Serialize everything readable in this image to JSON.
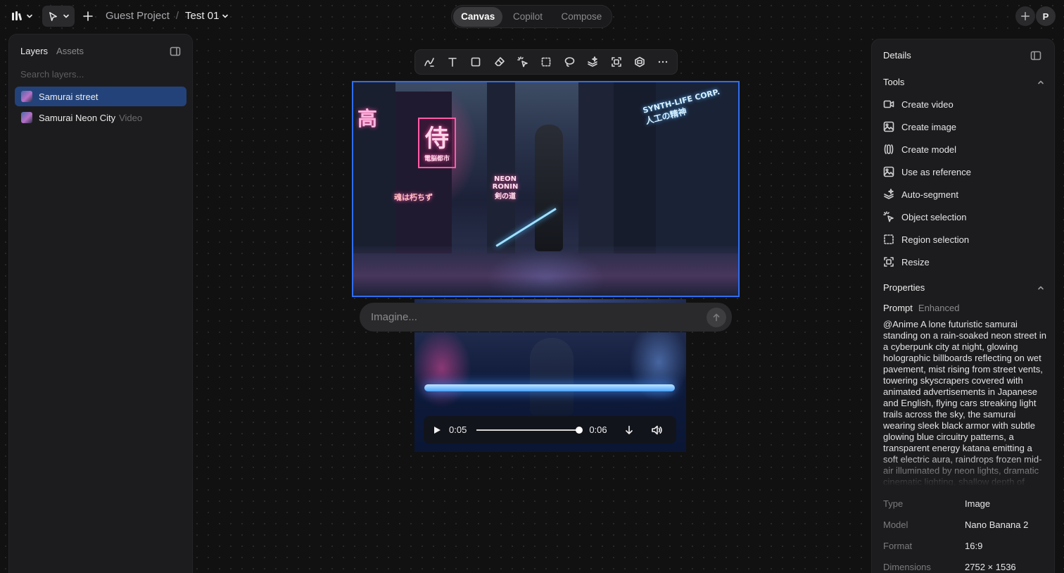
{
  "header": {
    "project": "Guest Project",
    "separator": "/",
    "file": "Test 01",
    "avatar_initial": "P",
    "modes": [
      {
        "label": "Canvas",
        "active": true
      },
      {
        "label": "Copilot",
        "active": false
      },
      {
        "label": "Compose",
        "active": false
      }
    ]
  },
  "left_panel": {
    "tabs": [
      {
        "label": "Layers",
        "active": true
      },
      {
        "label": "Assets",
        "active": false
      }
    ],
    "search_placeholder": "Search layers...",
    "layers": [
      {
        "name": "Samurai street",
        "tag": "",
        "selected": true
      },
      {
        "name": "Samurai Neon City",
        "tag": "Video",
        "selected": false
      }
    ]
  },
  "toolbar": {
    "tools": [
      "draw-icon",
      "text-icon",
      "rectangle-icon",
      "eraser-icon",
      "object-select-icon",
      "region-select-icon",
      "lasso-icon",
      "auto-segment-icon",
      "resize-icon",
      "model-icon",
      "more-icon"
    ]
  },
  "canvas": {
    "image_signs": {
      "left_kanji": "侍",
      "left_sub": "電脳都市",
      "neon_ronin": "NEON RONIN",
      "blade_way": "剣の道",
      "synth_corp": "SYNTH-LIFE CORP.",
      "synth_sub": "人工の精神",
      "vertical_left": "高",
      "soul_sign": "魂は朽ちず"
    },
    "prompt_placeholder": "Imagine...",
    "video": {
      "current_time": "0:05",
      "duration": "0:06",
      "progress": 1.0
    }
  },
  "details": {
    "title": "Details",
    "tools_heading": "Tools",
    "tools": [
      {
        "icon": "video-icon",
        "label": "Create video"
      },
      {
        "icon": "image-icon",
        "label": "Create image"
      },
      {
        "icon": "model-icon",
        "label": "Create model"
      },
      {
        "icon": "reference-icon",
        "label": "Use as reference"
      },
      {
        "icon": "auto-segment-icon",
        "label": "Auto-segment"
      },
      {
        "icon": "object-selection-icon",
        "label": "Object selection"
      },
      {
        "icon": "region-selection-icon",
        "label": "Region selection"
      },
      {
        "icon": "resize-icon",
        "label": "Resize"
      }
    ],
    "properties_heading": "Properties",
    "prompt_tabs": [
      {
        "label": "Prompt",
        "active": true
      },
      {
        "label": "Enhanced",
        "active": false
      }
    ],
    "prompt_text": "@Anime A lone futuristic samurai standing on a rain-soaked neon street in a cyberpunk city at night, glowing holographic billboards reflecting on wet pavement, mist rising from street vents, towering skyscrapers covered with animated advertisements in Japanese and English, flying cars streaking light trails across the sky, the samurai wearing sleek black armor with subtle glowing blue circuitry patterns, a transparent energy katana emitting a soft electric aura, raindrops frozen mid-air illuminated by neon lights, dramatic cinematic lighting, shallow depth of",
    "properties": [
      {
        "key": "Type",
        "value": "Image"
      },
      {
        "key": "Model",
        "value": "Nano Banana 2"
      },
      {
        "key": "Format",
        "value": "16:9"
      },
      {
        "key": "Dimensions",
        "value": "2752 × 1536"
      }
    ]
  },
  "colors": {
    "accent": "#2f6df0",
    "selected_layer": "#23427a",
    "background": "#111112",
    "panel": "#1c1c1e"
  }
}
